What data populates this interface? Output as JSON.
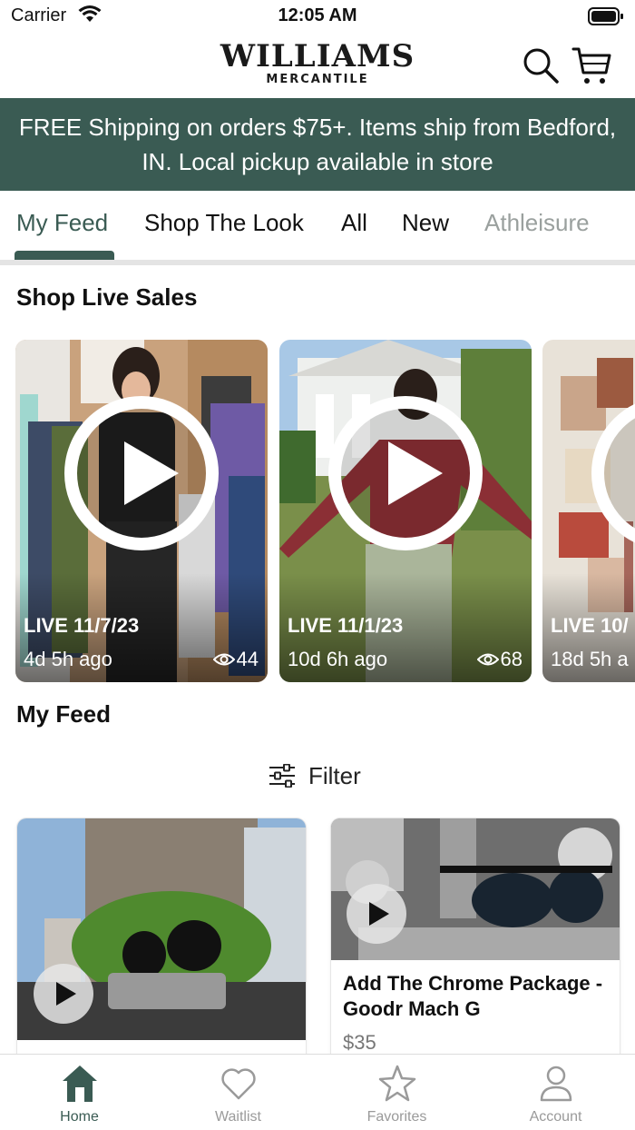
{
  "status_bar": {
    "carrier": "Carrier",
    "time": "12:05 AM"
  },
  "header": {
    "logo_text": "WILLIAMS",
    "logo_subtext": "MERCANTILE",
    "search_icon": "search-icon",
    "cart_icon": "cart-icon"
  },
  "banner": {
    "text": "FREE Shipping on orders $75+. Items ship from Bedford, IN. Local pickup available in store"
  },
  "tabs": [
    {
      "label": "My Feed",
      "active": true
    },
    {
      "label": "Shop The Look"
    },
    {
      "label": "All"
    },
    {
      "label": "New"
    },
    {
      "label": "Athleisure"
    }
  ],
  "live_section": {
    "title": "Shop Live Sales",
    "cards": [
      {
        "date": "LIVE 11/7/23",
        "ago": "4d 5h ago",
        "views": "44"
      },
      {
        "date": "LIVE 11/1/23",
        "ago": "10d 6h ago",
        "views": "68"
      },
      {
        "date": "LIVE 10/",
        "ago": "18d 5h a",
        "views": ""
      }
    ]
  },
  "feed_section": {
    "title": "My Feed",
    "filter_label": "Filter"
  },
  "products": [
    {
      "title": "",
      "price": ""
    },
    {
      "title": "Add The Chrome Package - Goodr Mach G",
      "price": "$35"
    }
  ],
  "bottom_nav": [
    {
      "label": "Home",
      "icon": "home-icon",
      "active": true
    },
    {
      "label": "Waitlist",
      "icon": "heart-icon"
    },
    {
      "label": "Favorites",
      "icon": "star-icon"
    },
    {
      "label": "Account",
      "icon": "person-icon"
    }
  ],
  "colors": {
    "accent": "#3a5b53",
    "inactive": "#9a9a9a"
  }
}
